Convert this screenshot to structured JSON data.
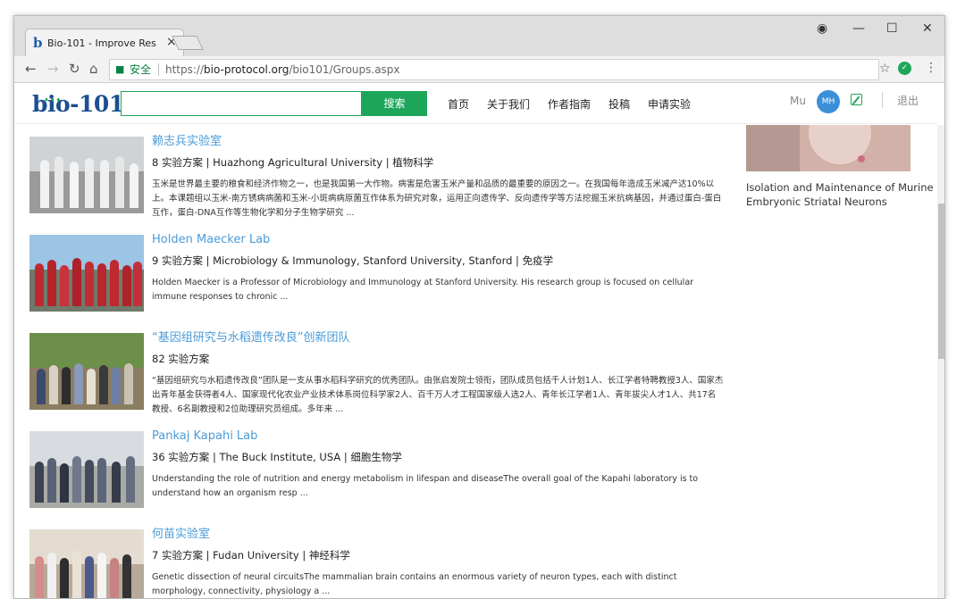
{
  "browser": {
    "tab_favicon": "b",
    "tab_title": "Bio-101 - Improve Res",
    "tab_close": "×",
    "secure_label": "安全",
    "url_scheme": "https://",
    "url_host": "bio-protocol.org",
    "url_path": "/bio101/Groups.aspx",
    "icons": [
      "back-icon",
      "forward-icon",
      "reload-icon",
      "home-icon",
      "lock-icon",
      "star-icon",
      "extension-icon",
      "menu-icon",
      "account-icon",
      "minimize-icon",
      "maximize-icon",
      "close-icon"
    ]
  },
  "header": {
    "logo": "bio-101",
    "search_button": "搜索",
    "nav": [
      "首页",
      "关于我们",
      "作者指南",
      "投稿",
      "申请实验"
    ],
    "user_name": "Mu",
    "avatar_initials": "MH",
    "logout": "退出",
    "accent_color": "#1da65a"
  },
  "labs": [
    {
      "name": "赖志兵实验室",
      "meta": "8 实验方案 | Huazhong Agricultural University | 植物科学",
      "desc": "玉米是世界最主要的粮食和经济作物之一，也是我国第一大作物。病害是危害玉米产量和品质的最重要的原因之一。在我国每年造成玉米减产达10%以上。本课题组以玉米-南方锈病病菌和玉米-小斑病病原菌互作体系为研究对象，运用正向遗传学、反向遗传学等方法挖掘玉米抗病基因，并通过蛋白-蛋白互作，蛋白-DNA互作等生物化学和分子生物学研究 ..."
    },
    {
      "name": "Holden Maecker Lab",
      "meta": "9 实验方案 | Microbiology & Immunology, Stanford University, Stanford | 免疫学",
      "desc": "Holden Maecker is a Professor of Microbiology and Immunology at Stanford University.  His research group is focused on cellular immune responses to chronic ..."
    },
    {
      "name": "“基因组研究与水稻遗传改良”创新团队",
      "meta": "82 实验方案",
      "desc": "“基因组研究与水稻遗传改良”团队是一支从事水稻科学研究的优秀团队。由张启发院士领衔，团队成员包括千人计划1人、长江学者特聘教授3人、国家杰出青年基金获得者4人、国家现代化农业产业技术体系岗位科学家2人、百千万人才工程国家级人选2人、青年长江学者1人、青年拔尖人才1人、共17名教授、6名副教授和2位助理研究员组成。多年来 ..."
    },
    {
      "name": "Pankaj Kapahi Lab",
      "meta": "36 实验方案 | The Buck Institute, USA | 细胞生物学",
      "desc": "Understanding the role of nutrition and energy metabolism in lifespan and diseaseThe overall goal of the Kapahi laboratory is to understand how an organism resp ..."
    },
    {
      "name": "何苗实验室",
      "meta": "7 实验方案 | Fudan University | 神经科学",
      "desc": "Genetic dissection of neural circuitsThe mammalian brain contains an enormous variety of neuron types, each with distinct morphology, connectivity, physiology a ..."
    }
  ],
  "sidebar": {
    "caption": "Isolation and Maintenance of Murine Embryonic Striatal Neurons"
  },
  "link_color": "#4a9bd8"
}
